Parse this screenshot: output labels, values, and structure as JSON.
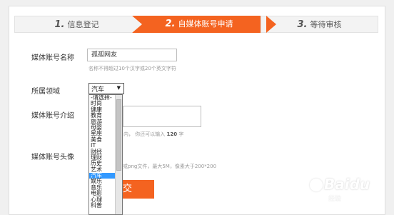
{
  "steps": [
    {
      "num": "1.",
      "label": "信息登记",
      "active": false
    },
    {
      "num": "2.",
      "label": "自媒体账号申请",
      "active": true
    },
    {
      "num": "3.",
      "label": "等待审核",
      "active": false
    }
  ],
  "colors": {
    "accent": "#f46320",
    "selected": "#3399ff"
  },
  "form": {
    "name_label": "媒体账号名称",
    "name_value": "孤孤网友",
    "name_hint": "名称不得超过10个汉字或20个英文字符",
    "domain_label": "所属领域",
    "domain_value": "汽车",
    "intro_label": "媒体账号介绍",
    "intro_hint_prefix": "内，  你还可以输入",
    "intro_hint_count": "120",
    "intro_hint_suffix": "字",
    "avatar_label": "媒体账号头像",
    "avatar_hint": "或png文件，最大5M，像素大于200*200",
    "submit_label": "交"
  },
  "dropdown_options": [
    "-请选择-",
    "时尚",
    "健康",
    "教育",
    "旅游",
    "母婴",
    "星座",
    "美食",
    "IT",
    "财经",
    "理财",
    "历史",
    "艺术",
    "汽车",
    "娱乐",
    "音乐",
    "电影",
    "心理",
    "科普"
  ],
  "dropdown_selected": "汽车",
  "watermark": {
    "brand": "Baidu",
    "sub": "经验"
  }
}
